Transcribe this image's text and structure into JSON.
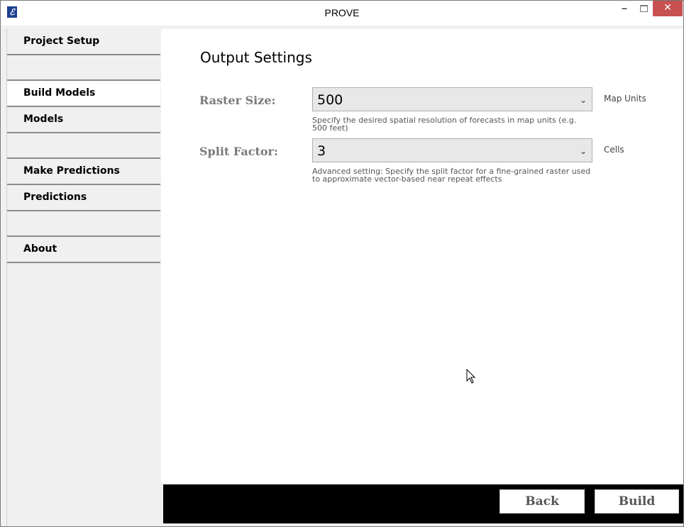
{
  "window": {
    "title": "PROVE",
    "app_icon": "ℰ",
    "minimize": "–",
    "close": "✕"
  },
  "sidebar": {
    "items": [
      {
        "label": "Project Setup"
      },
      {
        "label": "Build Models"
      },
      {
        "label": "Models"
      },
      {
        "label": "Make Predictions"
      },
      {
        "label": "Predictions"
      },
      {
        "label": "About"
      }
    ]
  },
  "main": {
    "heading": "Output Settings",
    "raster": {
      "label": "Raster Size:",
      "value": "500",
      "unit": "Map Units",
      "help": "Specify the desired spatial resolution of forecasts in map units (e.g. 500 feet)"
    },
    "split": {
      "label": "Split Factor:",
      "value": "3",
      "unit": "Cells",
      "help": "Advanced setting: Specify the split factor for a fine-grained raster used to approximate vector-based near repeat effects"
    }
  },
  "footer": {
    "back_label": "Back",
    "build_label": "Build"
  },
  "icons": {
    "dropdown": "chevron-down-icon",
    "cursor": "mouse-pointer-icon"
  },
  "colors": {
    "footer_bg": "#000000",
    "close_button": "#c75050",
    "selected_nav": "#ffffff"
  }
}
